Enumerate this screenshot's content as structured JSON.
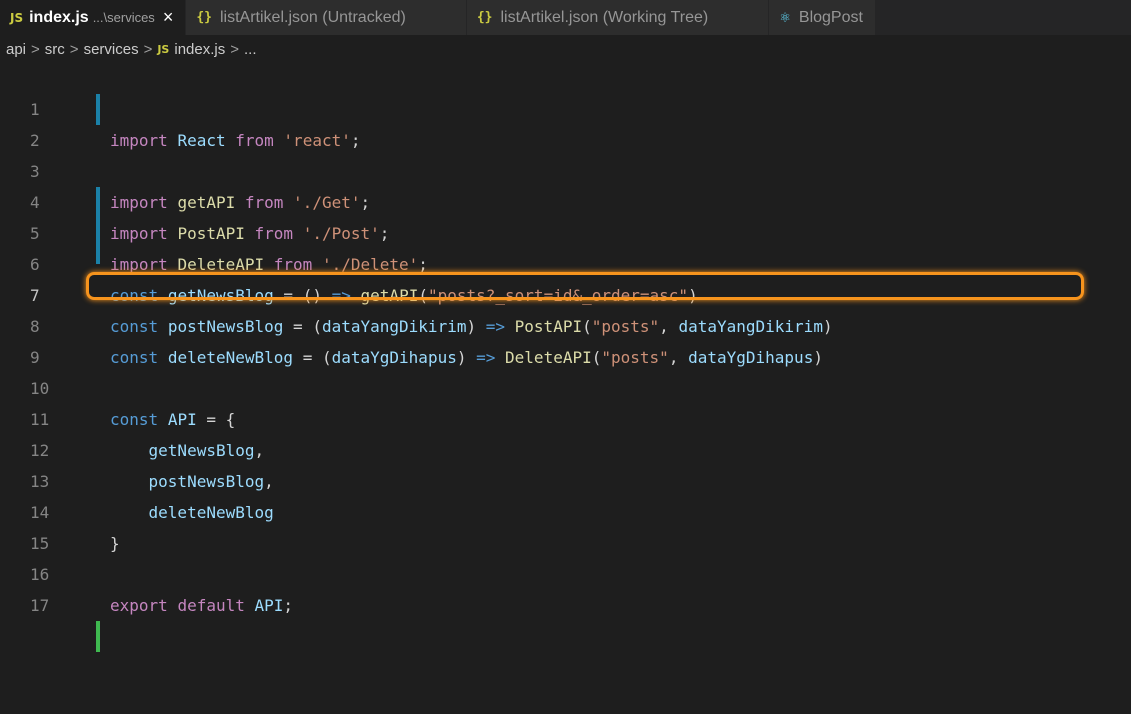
{
  "tabs": [
    {
      "label": "index.js",
      "desc": "...\\services",
      "active": true,
      "icon": "js-file-icon",
      "close": "×"
    },
    {
      "label": "listArtikel.json (Untracked)",
      "active": false,
      "icon": "json-file-icon"
    },
    {
      "label": "listArtikel.json (Working Tree)",
      "active": false,
      "icon": "json-file-icon"
    },
    {
      "label": "BlogPost",
      "active": false,
      "icon": "react-file-icon"
    }
  ],
  "icons": {
    "js": "JS",
    "json": "{}",
    "react": "⚛"
  },
  "breadcrumb": [
    "api",
    "src",
    "services",
    "index.js",
    "..."
  ],
  "breadcrumb_sep": ">",
  "lines": [
    {
      "n": "1",
      "code": "import React from 'react';"
    },
    {
      "n": "2",
      "code": "import getAPI from './Get';"
    },
    {
      "n": "3",
      "code": "import PostAPI from './Post';"
    },
    {
      "n": "4",
      "code": "import DeleteAPI from './Delete';"
    },
    {
      "n": "5",
      "code": ""
    },
    {
      "n": "6",
      "code": "const getNewsBlog = () => getAPI(\"posts?_sort=id&_order=asc\")"
    },
    {
      "n": "7",
      "code": "const postNewsBlog = (dataYangDikirim) => PostAPI(\"posts\", dataYangDikirim)"
    },
    {
      "n": "8",
      "code": "const deleteNewBlog = (dataYgDihapus) => DeleteAPI(\"posts\", dataYgDihapus)"
    },
    {
      "n": "9",
      "code": ""
    },
    {
      "n": "10",
      "code": "const API = {"
    },
    {
      "n": "11",
      "code": "    getNewsBlog,"
    },
    {
      "n": "12",
      "code": "    postNewsBlog,"
    },
    {
      "n": "13",
      "code": "    deleteNewBlog"
    },
    {
      "n": "14",
      "code": "}"
    },
    {
      "n": "15",
      "code": ""
    },
    {
      "n": "16",
      "code": "export default API;"
    },
    {
      "n": "17",
      "code": ""
    }
  ],
  "colors": {
    "background": "#1e1e1e",
    "highlight_border": "#f7941d",
    "modified_gutter": "#1b81a8",
    "added_gutter": "#3fb950"
  }
}
